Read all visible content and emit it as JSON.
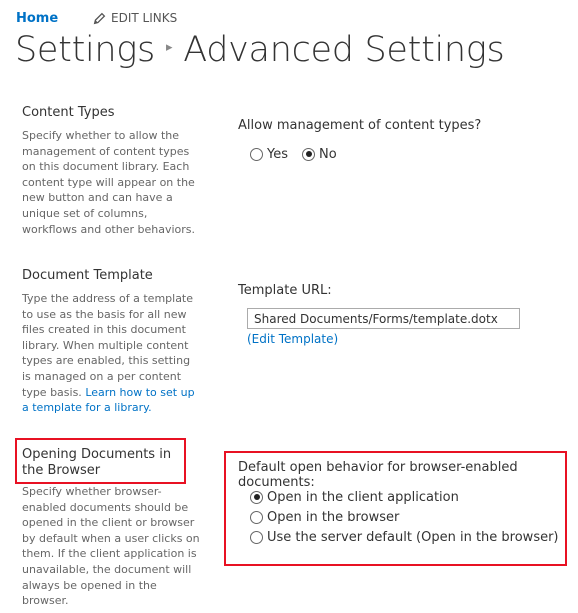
{
  "topnav": {
    "home_label": "Home",
    "edit_links_label": "EDIT LINKS",
    "edit_icon": "pencil-icon"
  },
  "breadcrumb": {
    "parent": "Settings",
    "separator": "▸",
    "current": "Advanced Settings"
  },
  "content_types": {
    "title": "Content Types",
    "description": "Specify whether to allow the management of content types on this document library. Each content type will appear on the new button and can have a unique set of columns, workflows and other behaviors.",
    "question": "Allow management of content types?",
    "options": [
      {
        "label": "Yes",
        "checked": false
      },
      {
        "label": "No",
        "checked": true
      }
    ]
  },
  "document_template": {
    "title": "Document Template",
    "description": "Type the address of a template to use as the basis for all new files created in this document library. When multiple content types are enabled, this setting is managed on a per content type basis.",
    "help_link": "Learn how to set up a template for a library.",
    "url_label": "Template URL:",
    "url_value": "Shared Documents/Forms/template.dotx",
    "edit_link": "(Edit Template)"
  },
  "opening_documents": {
    "title": "Opening Documents in the Browser",
    "description": "Specify whether browser-enabled documents should be opened in the client or browser by default when a user clicks on them. If the client application is unavailable, the document will always be opened in the browser.",
    "question": "Default open behavior for browser-enabled documents:",
    "options": [
      {
        "label": "Open in the client application",
        "checked": true
      },
      {
        "label": "Open in the browser",
        "checked": false
      },
      {
        "label": "Use the server default (Open in the browser)",
        "checked": false
      }
    ]
  },
  "colors": {
    "link": "#0072c6",
    "highlight": "#e81123"
  }
}
